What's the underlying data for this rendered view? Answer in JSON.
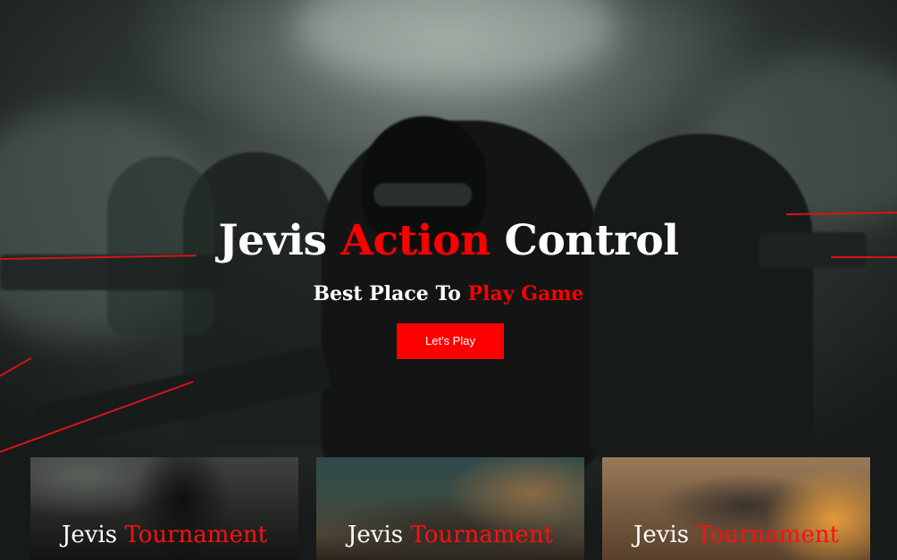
{
  "hero": {
    "title_part1": "Jevis ",
    "title_accent": "Action",
    "title_part2": " Control",
    "subtitle_part1": "Best Place To ",
    "subtitle_accent": "Play Game",
    "cta_label": "Let's Play"
  },
  "tournaments": [
    {
      "name": "Jevis ",
      "accent": "Tournament"
    },
    {
      "name": "Jevis ",
      "accent": "Tournament"
    },
    {
      "name": "Jevis ",
      "accent": "Tournament"
    }
  ],
  "colors": {
    "accent": "#ff0000",
    "text": "#ffffff",
    "background": "#2d3531"
  }
}
